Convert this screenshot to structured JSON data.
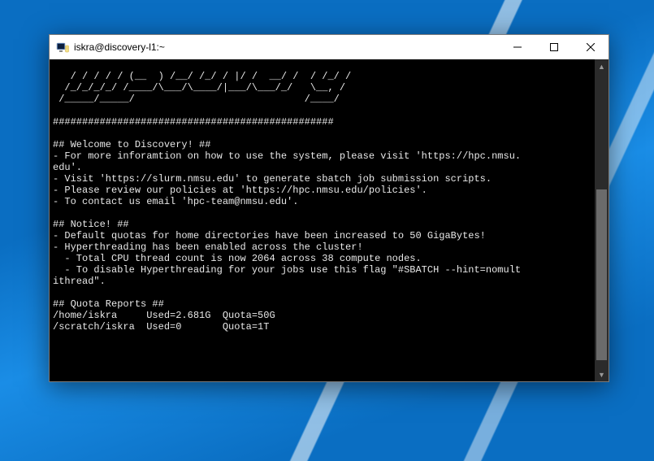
{
  "window": {
    "title": "iskra@discovery-l1:~"
  },
  "terminal": {
    "lines": [
      "   / / / / / (__  ) /__/ /_/ / |/ /  __/ /  / /_/ /",
      "  /_/_/_/_/ /____/\\___/\\____/|___/\\___/_/   \\__, /",
      " /_____/_____/                             /____/",
      "",
      "################################################",
      "",
      "## Welcome to Discovery! ##",
      "- For more inforamtion on how to use the system, please visit 'https://hpc.nmsu.",
      "edu'.",
      "- Visit 'https://slurm.nmsu.edu' to generate sbatch job submission scripts.",
      "- Please review our policies at 'https://hpc.nmsu.edu/policies'.",
      "- To contact us email 'hpc-team@nmsu.edu'.",
      "",
      "## Notice! ##",
      "- Default quotas for home directories have been increased to 50 GigaBytes!",
      "- Hyperthreading has been enabled across the cluster!",
      "  - Total CPU thread count is now 2064 across 38 compute nodes.",
      "  - To disable Hyperthreading for your jobs use this flag \"#SBATCH --hint=nomult",
      "ithread\".",
      "",
      "## Quota Reports ##",
      "/home/iskra     Used=2.681G  Quota=50G",
      "/scratch/iskra  Used=0       Quota=1T"
    ]
  }
}
